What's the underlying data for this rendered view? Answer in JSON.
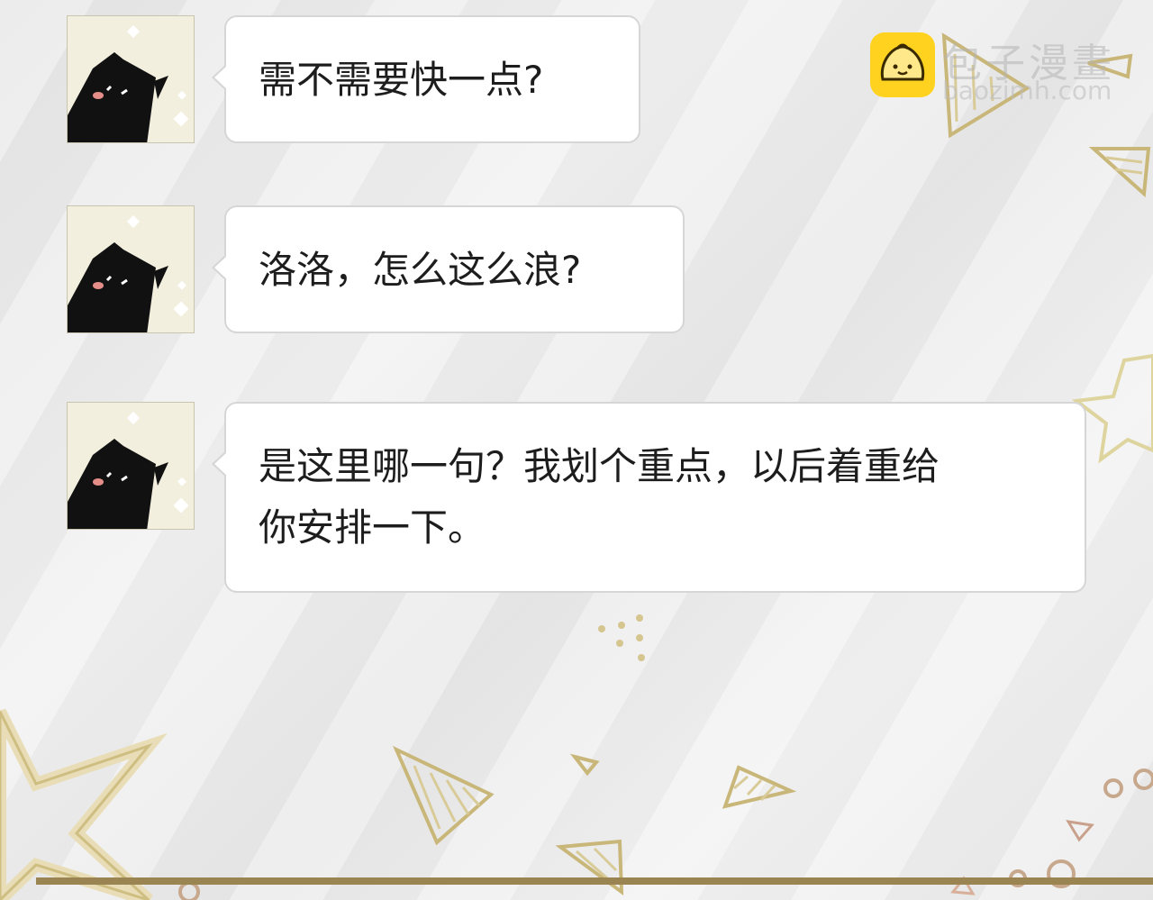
{
  "messages": [
    {
      "text": "需不需要快一点?"
    },
    {
      "text": "洛洛，怎么这么浪?"
    },
    {
      "line1": "是这里哪一句？我划个重点，以后着重给",
      "line2": "你安排一下。"
    }
  ],
  "watermark": {
    "title": "包子漫畫",
    "url": "baozimh.com"
  },
  "colors": {
    "bubble_bg": "#ffffff",
    "bubble_border": "#d6d6d6",
    "avatar_bg": "#f2efdf",
    "cat": "#111111",
    "deco_gold": "#cfbe82",
    "logo_yellow": "#ffd21f"
  },
  "icons": [
    "cat-avatar-icon",
    "baozi-logo-icon",
    "star-icon",
    "triangle-icon",
    "flower-icon"
  ]
}
